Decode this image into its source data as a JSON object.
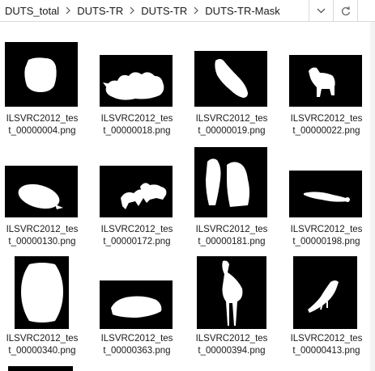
{
  "breadcrumb": [
    "DUTS_total",
    "DUTS-TR",
    "DUTS-TR",
    "DUTS-TR-Mask"
  ],
  "icons": {
    "dropdown": "chevron-down-icon",
    "refresh": "refresh-icon",
    "separator": "chevron-right-icon"
  },
  "files": [
    {
      "name_line1": "ILSVRC2012_tes",
      "name_line2": "t_00000004.png"
    },
    {
      "name_line1": "ILSVRC2012_tes",
      "name_line2": "t_00000018.png"
    },
    {
      "name_line1": "ILSVRC2012_tes",
      "name_line2": "t_00000019.png"
    },
    {
      "name_line1": "ILSVRC2012_tes",
      "name_line2": "t_00000022.png"
    },
    {
      "name_line1": "ILSVRC2012_tes",
      "name_line2": "t_00000130.png"
    },
    {
      "name_line1": "ILSVRC2012_tes",
      "name_line2": "t_00000172.png"
    },
    {
      "name_line1": "ILSVRC2012_tes",
      "name_line2": "t_00000181.png"
    },
    {
      "name_line1": "ILSVRC2012_tes",
      "name_line2": "t_00000198.png"
    },
    {
      "name_line1": "ILSVRC2012_tes",
      "name_line2": "t_00000340.png"
    },
    {
      "name_line1": "ILSVRC2012_tes",
      "name_line2": "t_00000363.png"
    },
    {
      "name_line1": "ILSVRC2012_tes",
      "name_line2": "t_00000394.png"
    },
    {
      "name_line1": "ILSVRC2012_tes",
      "name_line2": "t_00000413.png"
    }
  ]
}
